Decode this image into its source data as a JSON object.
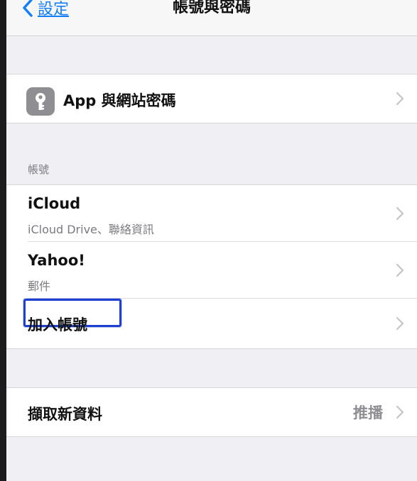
{
  "navbar": {
    "back_label": "設定",
    "title": "帳號與密碼"
  },
  "passwords_row": {
    "label": "App 與網站密碼",
    "icon": "key-icon"
  },
  "accounts_section": {
    "header": "帳號",
    "items": [
      {
        "title": "iCloud",
        "subtitle": "iCloud Drive、聯絡資訊"
      },
      {
        "title": "Yahoo!",
        "subtitle": "郵件"
      }
    ],
    "add_account_label": "加入帳號"
  },
  "fetch_row": {
    "label": "擷取新資料",
    "value": "推播"
  },
  "colors": {
    "accent": "#147efb",
    "highlight_border": "#1e3fd0",
    "grouped_background": "#efeff4"
  }
}
